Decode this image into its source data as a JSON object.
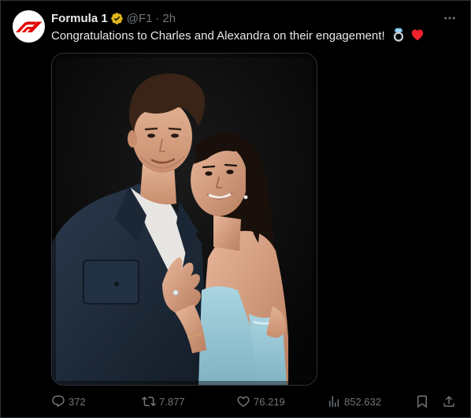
{
  "tweet": {
    "display_name": "Formula 1",
    "handle": "@F1",
    "separator": "·",
    "time": "2h",
    "text": "Congratulations to Charles and Alexandra on their engagement!",
    "emojis": [
      "ring-emoji",
      "red-heart-emoji"
    ]
  },
  "media": {
    "kind": "photo"
  },
  "actions": {
    "replies": "372",
    "retweets": "7.877",
    "likes": "76.219",
    "views": "852.632"
  },
  "colors": {
    "background": "#000000",
    "text": "#e7e9ea",
    "muted": "#71767b",
    "brand_red": "#e10600",
    "verified_gold": "#e2b719",
    "heart": "#f4212e"
  },
  "icons": [
    "f1-logo-icon",
    "verified-badge-icon",
    "more-icon",
    "reply-icon",
    "retweet-icon",
    "like-icon",
    "views-icon",
    "bookmark-icon",
    "share-icon"
  ]
}
